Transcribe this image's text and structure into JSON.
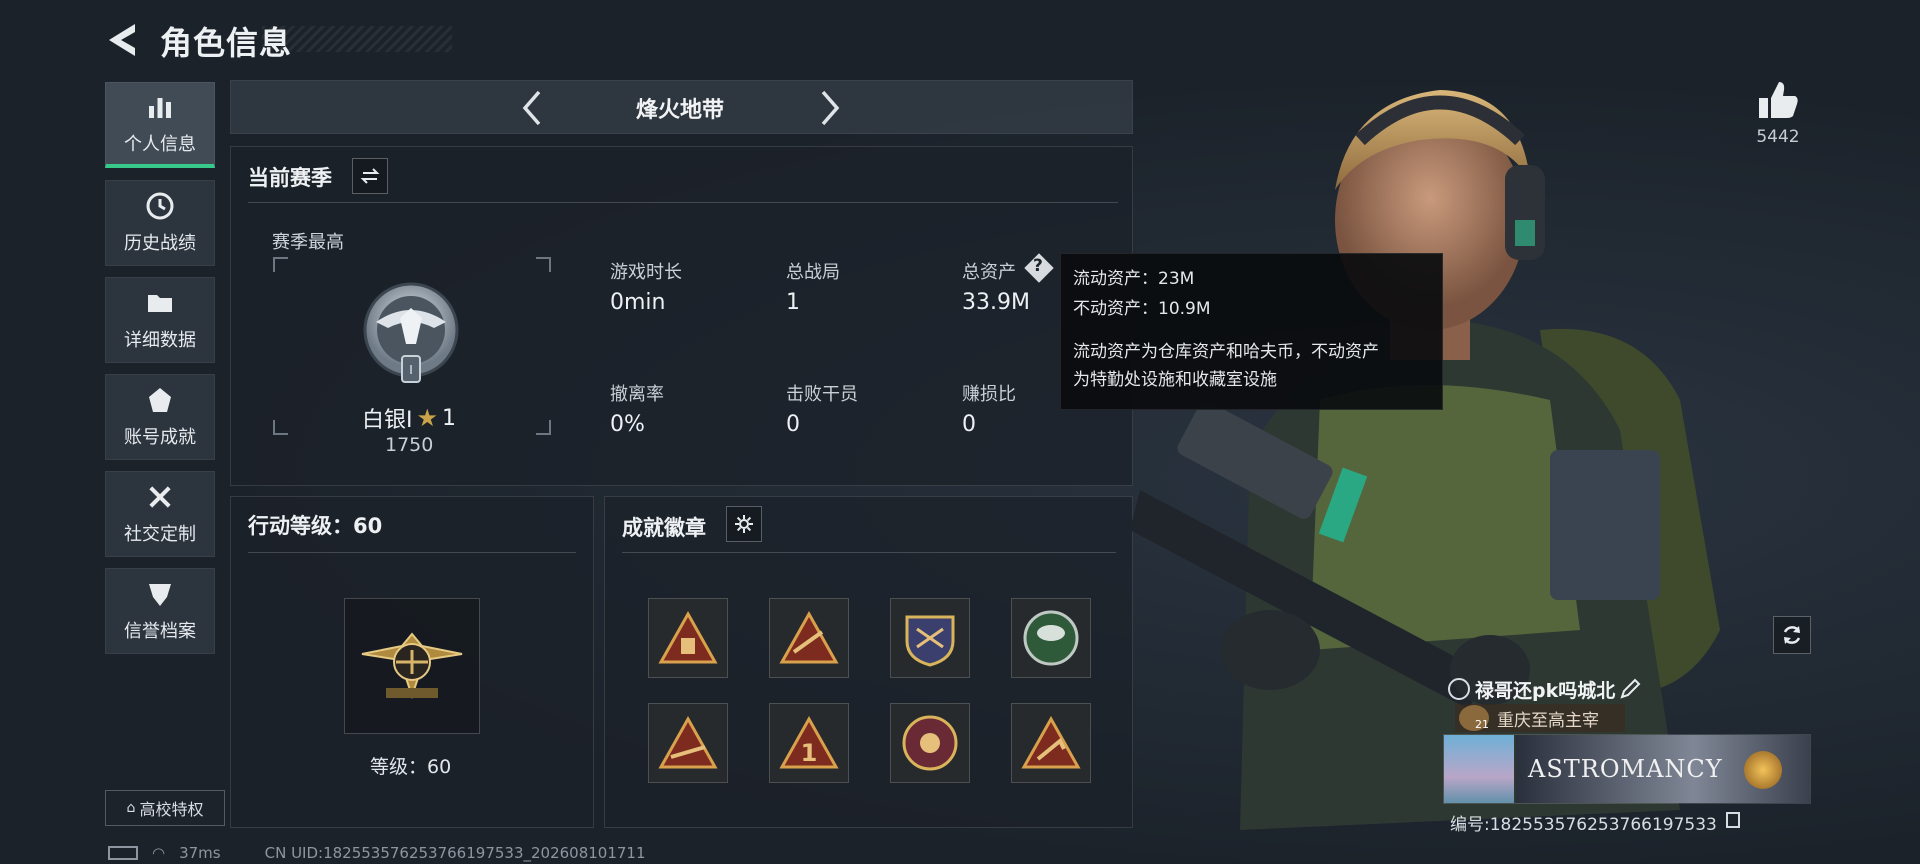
{
  "header": {
    "title": "角色信息"
  },
  "sidebar": {
    "items": [
      {
        "label": "个人信息",
        "icon": "bar-chart-icon"
      },
      {
        "label": "历史战绩",
        "icon": "clock-icon"
      },
      {
        "label": "详细数据",
        "icon": "folder-icon"
      },
      {
        "label": "账号成就",
        "icon": "achievement-icon"
      },
      {
        "label": "社交定制",
        "icon": "tools-icon"
      },
      {
        "label": "信誉档案",
        "icon": "shield-icon"
      }
    ],
    "campus_label": "高校特权"
  },
  "mode_bar": {
    "mode_name": "烽火地带"
  },
  "season": {
    "title": "当前赛季",
    "highest_label": "赛季最高",
    "rank_name": "白银I",
    "rank_stars": "1",
    "rank_score": "1750",
    "stats": [
      {
        "label": "游戏时长",
        "value": "0min"
      },
      {
        "label": "总战局",
        "value": "1"
      },
      {
        "label": "总资产",
        "value": "33.9M"
      },
      {
        "label": "撤离率",
        "value": "0%"
      },
      {
        "label": "击败干员",
        "value": "0"
      },
      {
        "label": "赚损比",
        "value": "0"
      }
    ]
  },
  "tooltip": {
    "liquid": "流动资产：23M",
    "fixed": "不动资产：10.9M",
    "desc_line1": "流动资产为仓库资产和哈夫币，不动资产",
    "desc_line2": "为特勤处设施和收藏室设施"
  },
  "action_level": {
    "title": "行动等级：60",
    "level_label": "等级：60"
  },
  "badges": {
    "title": "成就徽章"
  },
  "profile": {
    "likes": "5442",
    "nickname": "禄哥还pk吗城北",
    "region_level": "21",
    "region": "重庆至高主宰",
    "card_text": "ASTROMANCY",
    "id_line": "编号:182553576253766197533"
  },
  "status": {
    "ping": "37ms",
    "uid": "CN UID:182553576253766197533_202608101711"
  },
  "colors": {
    "accent": "#37c98a",
    "gold": "#c9a24a"
  }
}
